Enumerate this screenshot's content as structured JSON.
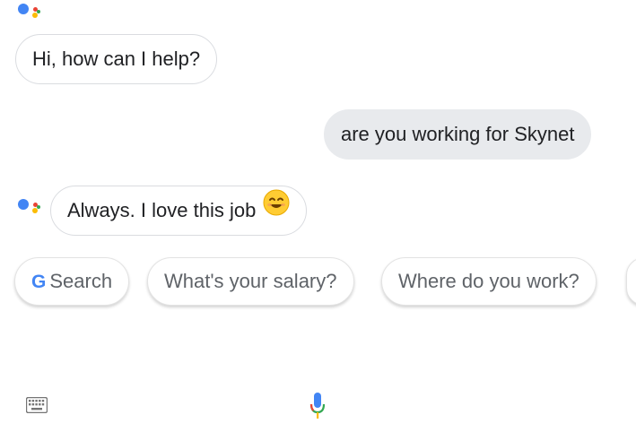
{
  "conversation": {
    "messages": [
      {
        "role": "assistant",
        "text": "Hi, how can I help?"
      },
      {
        "role": "user",
        "text": "are you working for Skynet"
      },
      {
        "role": "assistant",
        "text": "Always. I love this job"
      }
    ]
  },
  "suggestions": {
    "chips": [
      {
        "label": "Search",
        "icon": "google-g-icon"
      },
      {
        "label": "What's your salary?"
      },
      {
        "label": "Where do you work?"
      }
    ]
  },
  "input_bar": {
    "keyboard_icon": "keyboard-icon",
    "mic_icon": "microphone-icon"
  },
  "colors": {
    "google_blue": "#4285F4",
    "google_red": "#EA4335",
    "google_yellow": "#FBBC05",
    "google_green": "#34A853",
    "user_bubble": "#e8eaed",
    "chip_text": "#5f6368"
  }
}
